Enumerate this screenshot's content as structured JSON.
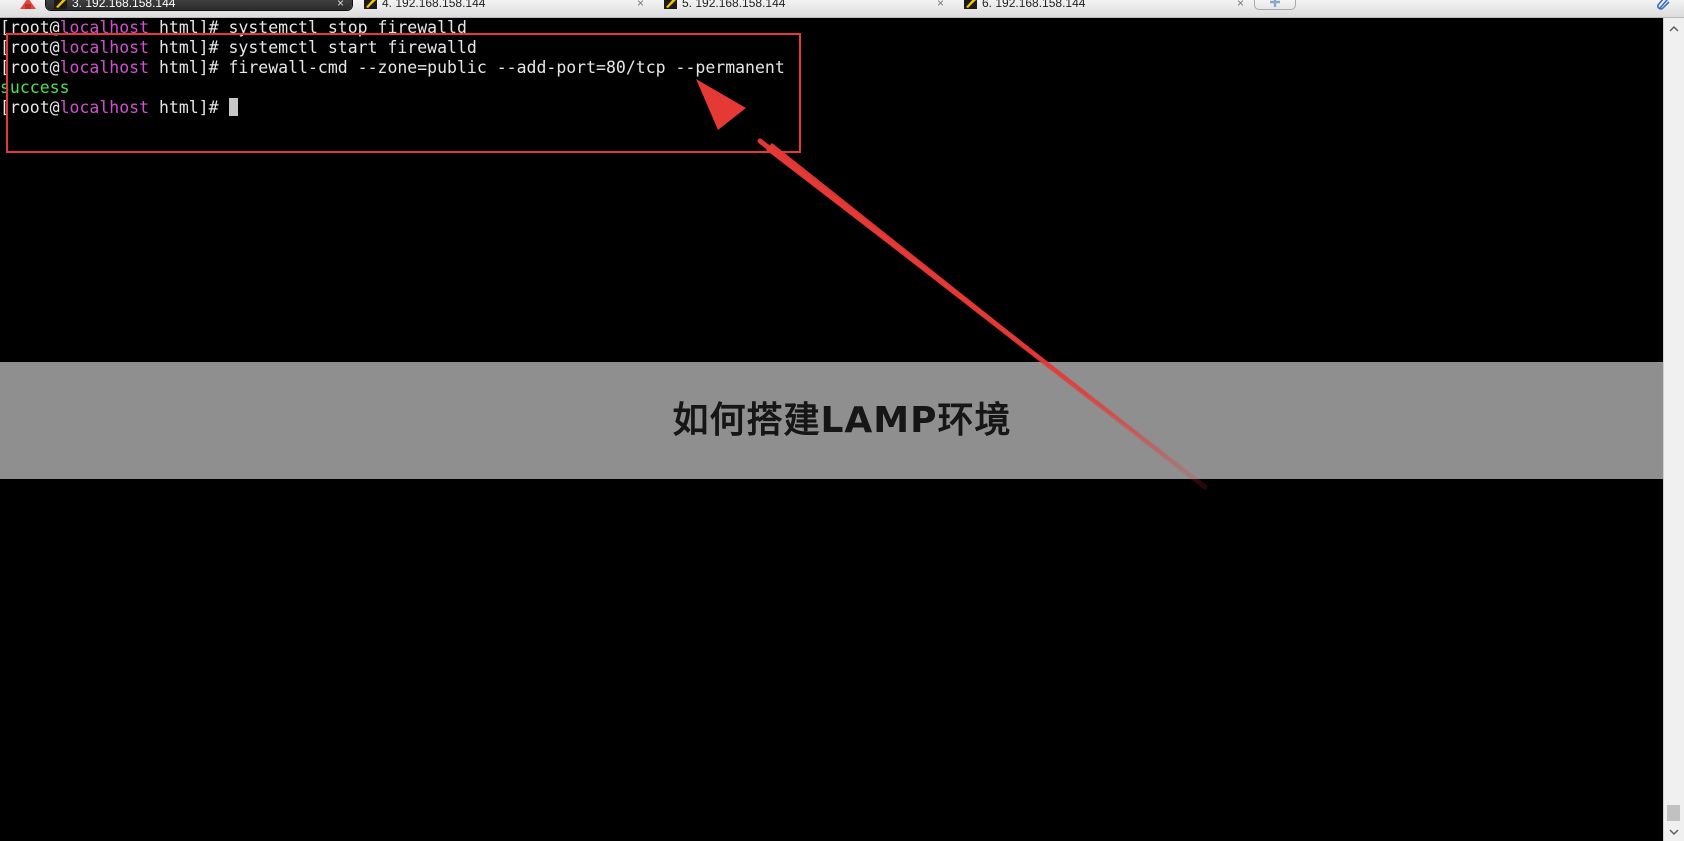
{
  "tabs": [
    {
      "label": "3. 192.168.158.144",
      "active": true
    },
    {
      "label": "4. 192.168.158.144",
      "active": false
    },
    {
      "label": "5. 192.168.158.144",
      "active": false
    },
    {
      "label": "6. 192.168.158.144",
      "active": false
    }
  ],
  "tab_close_glyph": "×",
  "terminal": {
    "lines": [
      {
        "pre": "[root@",
        "host": "localhost",
        "post": " html]# ",
        "cmd": "systemctl stop firewalld"
      },
      {
        "pre": "[root@",
        "host": "localhost",
        "post": " html]# ",
        "cmd": "systemctl start firewalld"
      },
      {
        "pre": "[root@",
        "host": "localhost",
        "post": " html]# ",
        "cmd": "firewall-cmd --zone=public --add-port=80/tcp --permanent"
      },
      {
        "output": "success"
      },
      {
        "pre": "[root@",
        "host": "localhost",
        "post": " html]# ",
        "cmd": ""
      }
    ]
  },
  "overlay": {
    "title": "如何搭建LAMP环境"
  },
  "icons": {
    "app": "app-logo-icon",
    "tab": "putty-terminal-icon",
    "new_tab": "plus-icon",
    "toolbar": "paperclip-icon"
  },
  "colors": {
    "terminal_background": "#000000",
    "prompt_host": "#d24fd1",
    "success_text": "#4ce04c",
    "annotation_red": "#e53935"
  }
}
